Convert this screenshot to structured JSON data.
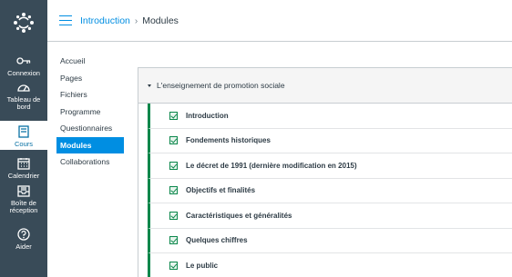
{
  "global_nav": {
    "items": [
      {
        "label": "Connexion",
        "icon": "key-icon"
      },
      {
        "label": "Tableau de bord",
        "icon": "dashboard-icon"
      },
      {
        "label": "Cours",
        "icon": "courses-icon",
        "active": true
      },
      {
        "label": "Calendrier",
        "icon": "calendar-icon"
      },
      {
        "label": "Boîte de réception",
        "icon": "inbox-icon"
      },
      {
        "label": "Aider",
        "icon": "help-icon"
      }
    ]
  },
  "breadcrumb": {
    "course": "Introduction",
    "separator": "›",
    "current": "Modules"
  },
  "course_nav": {
    "items": [
      "Accueil",
      "Pages",
      "Fichiers",
      "Programme",
      "Questionnaires",
      "Modules",
      "Collaborations"
    ],
    "active": "Modules"
  },
  "module": {
    "title": "L'enseignement de promotion sociale",
    "items": [
      "Introduction",
      "Fondements historiques",
      "Le décret de 1991 (dernière modification en 2015)",
      "Objectifs et finalités",
      "Caractéristiques et généralités",
      "Quelques chiffres",
      "Le public"
    ]
  },
  "colors": {
    "nav_bg": "#394b58",
    "accent": "#008ee2",
    "published_green": "#0b874b"
  }
}
